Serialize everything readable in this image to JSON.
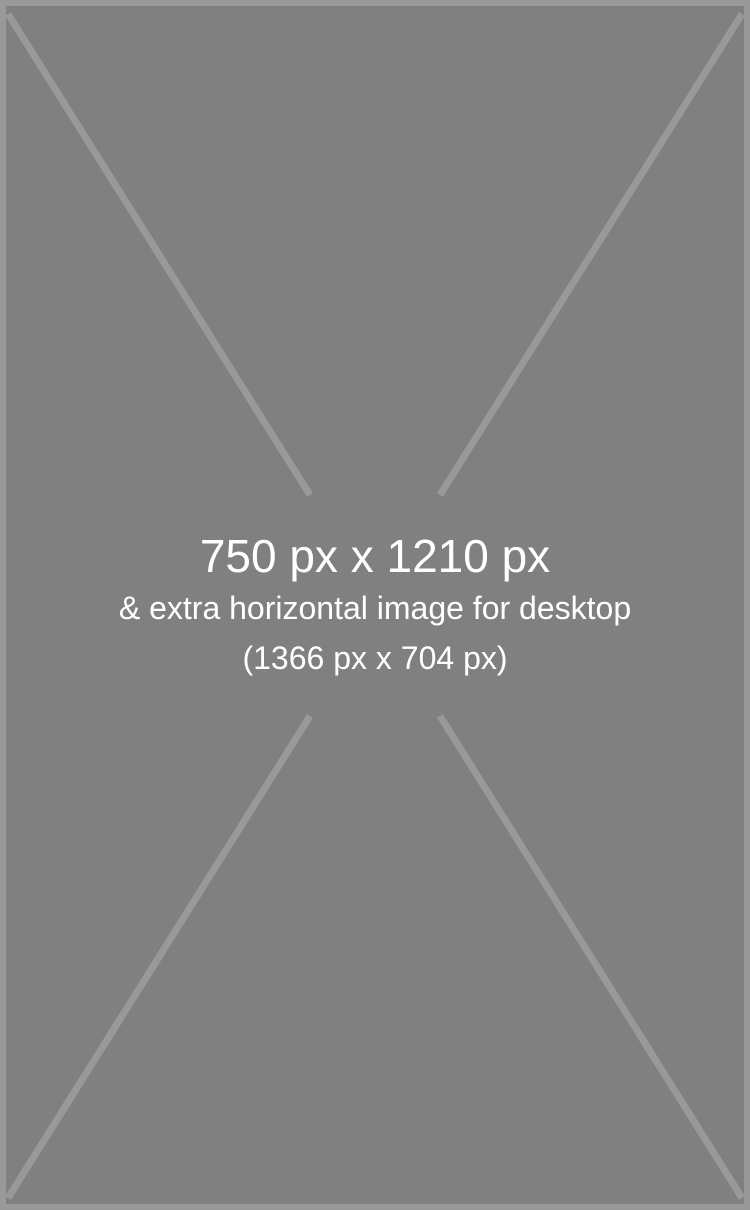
{
  "placeholder": {
    "title": "750 px x 1210 px",
    "subtitle": "& extra horizontal image for desktop",
    "extra": "(1366 px x 704 px)"
  },
  "colors": {
    "background": "#808080",
    "lines": "#999999",
    "text": "#ffffff"
  }
}
